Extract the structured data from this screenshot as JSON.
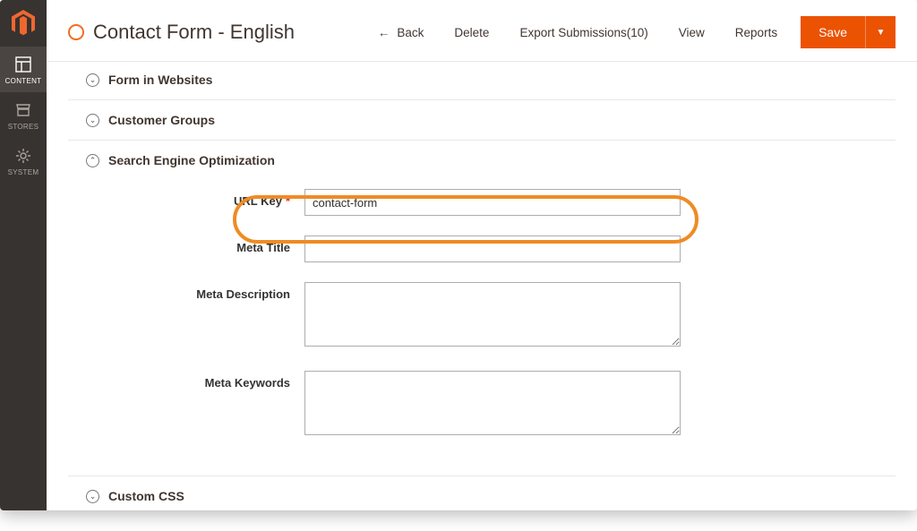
{
  "sidebar": {
    "items": [
      {
        "label": "CONTENT",
        "icon": "content"
      },
      {
        "label": "STORES",
        "icon": "stores"
      },
      {
        "label": "SYSTEM",
        "icon": "system"
      }
    ],
    "activeIndex": 0
  },
  "header": {
    "title": "Contact Form - English",
    "actions": {
      "back": "Back",
      "delete": "Delete",
      "export": "Export Submissions(10)",
      "view": "View",
      "reports": "Reports",
      "save": "Save"
    }
  },
  "sections": {
    "formInWebsites": {
      "title": "Form in Websites",
      "expanded": false
    },
    "customerGroups": {
      "title": "Customer Groups",
      "expanded": false
    },
    "seo": {
      "title": "Search Engine Optimization",
      "expanded": true,
      "fields": {
        "urlKey": {
          "label": "URL Key",
          "value": "contact-form",
          "required": true
        },
        "metaTitle": {
          "label": "Meta Title",
          "value": ""
        },
        "metaDescription": {
          "label": "Meta Description",
          "value": ""
        },
        "metaKeywords": {
          "label": "Meta Keywords",
          "value": ""
        }
      }
    },
    "customCss": {
      "title": "Custom CSS",
      "expanded": false
    }
  },
  "colors": {
    "accent": "#eb5202",
    "highlight": "#ef8b24"
  }
}
